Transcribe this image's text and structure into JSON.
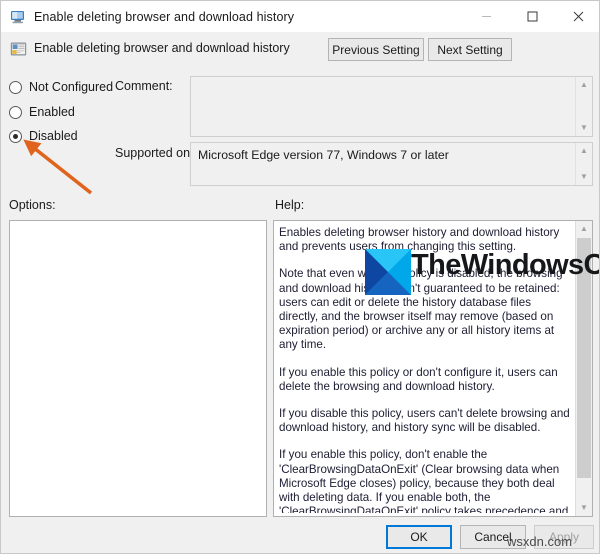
{
  "window": {
    "title": "Enable deleting browser and download history",
    "icon": "computer-policy-icon",
    "controls": {
      "minimize": "—",
      "maximize": "□",
      "close": "✕"
    }
  },
  "header": {
    "icon": "policy-setting-icon",
    "title": "Enable deleting browser and download history",
    "previous_setting_label": "Previous Setting",
    "next_setting_label": "Next Setting"
  },
  "state_options": {
    "items": [
      {
        "id": "not-configured",
        "label": "Not Configured",
        "selected": false
      },
      {
        "id": "enabled",
        "label": "Enabled",
        "selected": false
      },
      {
        "id": "disabled",
        "label": "Disabled",
        "selected": true
      }
    ]
  },
  "fields": {
    "comment_label": "Comment:",
    "comment_value": "",
    "supported_label": "Supported on:",
    "supported_value": "Microsoft Edge version 77, Windows 7 or later"
  },
  "panels": {
    "options_label": "Options:",
    "options_content": "",
    "help_label": "Help:",
    "help_paragraphs": [
      "Enables deleting browser history and download history and prevents users from changing this setting.",
      "Note that even with this policy is disabled, the browsing and download history aren't guaranteed to be retained: users can edit or delete the history database files directly, and the browser itself may remove (based on expiration period) or archive any or all history items at any time.",
      "If you enable this policy or don't configure it, users can delete the browsing and download history.",
      "If you disable this policy, users can't delete browsing and download history, and history sync will be disabled.",
      "If you enable this policy, don't enable the 'ClearBrowsingDataOnExit' (Clear browsing data when Microsoft Edge closes) policy, because they both deal with deleting data. If you enable both, the 'ClearBrowsingDataOnExit' policy takes precedence and deletes all data when Microsoft Edge closes, regardless of how this policy is configured."
    ]
  },
  "footer": {
    "ok_label": "OK",
    "cancel_label": "Cancel",
    "apply_label": "Apply",
    "apply_enabled": false
  },
  "annotations": {
    "arrow_color": "#e0641e",
    "arrow_target": "disabled-radio",
    "watermark_text": "TheWindowsClub",
    "watermark_bottom_text": "wsxdn.com"
  },
  "colors": {
    "titlebar_bg": "#ffffff",
    "dialog_bg": "#f0f0f0",
    "panel_bg": "#ffffff",
    "accent": "#0078d7",
    "text": "#1a1a1a"
  }
}
